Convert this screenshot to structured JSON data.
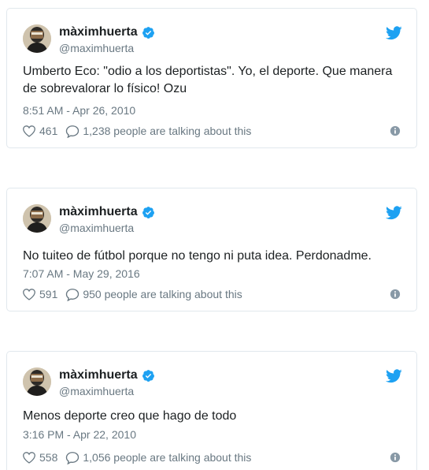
{
  "accent_color": "#1da1f2",
  "tweets": [
    {
      "name": "màximhuerta",
      "handle": "@maximhuerta",
      "text": "Umberto Eco: \"odio a los deportistas\". Yo, el deporte. Que manera de sobrevalorar lo físico! Ozu",
      "timestamp": "8:51 AM - Apr 26, 2010",
      "likes": "461",
      "talking": "1,238 people are talking about this"
    },
    {
      "name": "màximhuerta",
      "handle": "@maximhuerta",
      "text": "No tuiteo de fútbol porque no tengo ni puta idea. Perdonadme.",
      "timestamp": "7:07 AM - May 29, 2016",
      "likes": "591",
      "talking": "950 people are talking about this"
    },
    {
      "name": "màximhuerta",
      "handle": "@maximhuerta",
      "text": "Menos deporte creo que hago de todo",
      "timestamp": "3:16 PM - Apr 22, 2010",
      "likes": "558",
      "talking": "1,056 people are talking about this"
    }
  ],
  "icons": {
    "brand": "twitter-bird-icon",
    "verified": "verified-badge-icon",
    "like": "heart-icon",
    "reply": "speech-bubble-icon",
    "info": "info-icon"
  }
}
